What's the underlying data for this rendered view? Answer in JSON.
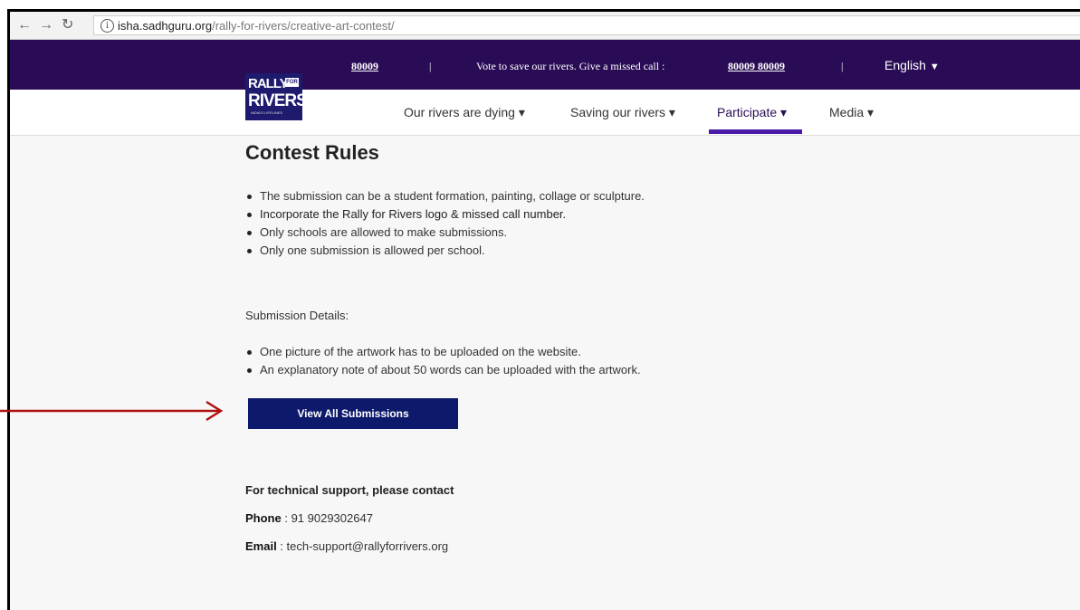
{
  "browser": {
    "back_icon": "arrow-left-icon",
    "forward_icon": "arrow-right-icon",
    "reload_icon": "reload-icon",
    "url_host": "isha.sadhguru.org",
    "url_path": "/rally-for-rivers/creative-art-contest/"
  },
  "topbar": {
    "number_left": "80009",
    "separator": "|",
    "vote_text": "Vote to save our rivers. Give a missed call :",
    "vote_number": "80009 80009",
    "language": "English",
    "language_caret": "▼"
  },
  "logo": {
    "line1": "RALLY",
    "for": "FOR",
    "line2": "RIVERS",
    "tagline": "INDIA'S LIFELINES"
  },
  "nav": {
    "items": [
      {
        "label": "Our rivers are dying ▾"
      },
      {
        "label": "Saving our rivers ▾"
      },
      {
        "label": "Participate ▾"
      },
      {
        "label": "Media ▾"
      }
    ]
  },
  "content": {
    "heading": "Contest Rules",
    "rules": [
      "The submission can be a student formation, painting, collage or sculpture.",
      "Incorporate the Rally for Rivers logo & missed call number.",
      "Only schools are allowed to make submissions.",
      "Only one submission is allowed per school."
    ],
    "submission_heading": "Submission Details:",
    "submission_items": [
      "One picture of the artwork has to be uploaded on the website.",
      "An explanatory note of about 50 words can be uploaded with the artwork."
    ],
    "button_label": "View All Submissions",
    "support_heading": "For technical support, please contact",
    "phone_label": "Phone",
    "phone_value": " : 91 9029302647",
    "email_label": "Email",
    "email_value": " : tech-support@rallyforrivers.org"
  },
  "colors": {
    "topbar": "#2a0c56",
    "button": "#0d1a6b",
    "annotation_arrow": "#b01010"
  }
}
